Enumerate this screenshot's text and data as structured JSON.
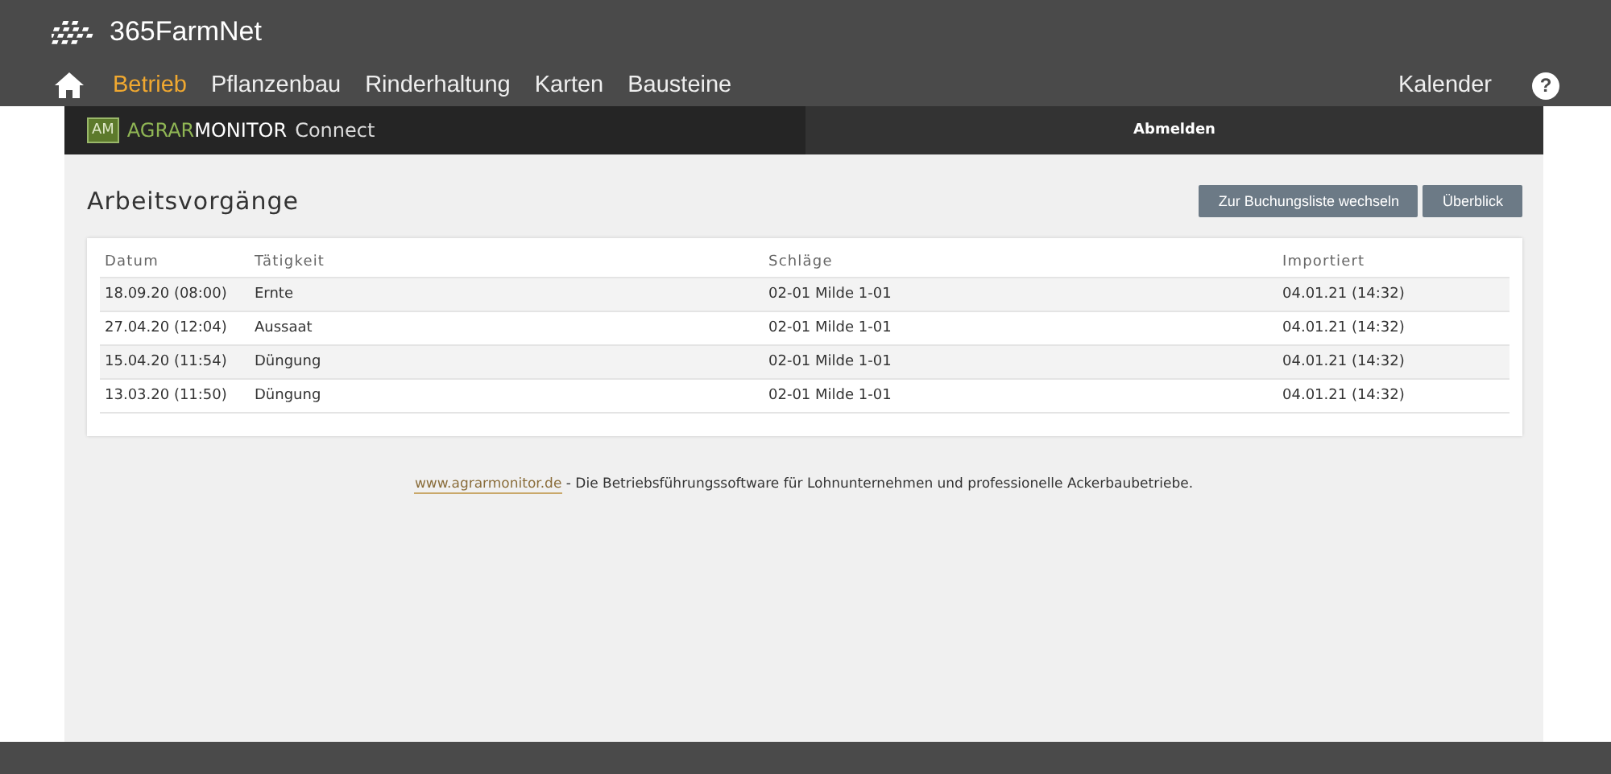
{
  "header": {
    "logo_text": "365FarmNet",
    "nav": [
      {
        "label": "Betrieb",
        "selected": true
      },
      {
        "label": "Pflanzenbau",
        "selected": false
      },
      {
        "label": "Rinderhaltung",
        "selected": false
      },
      {
        "label": "Karten",
        "selected": false
      },
      {
        "label": "Bausteine",
        "selected": false
      }
    ],
    "calendar": "Kalender",
    "help": "?"
  },
  "app_bar": {
    "logo_mark": "AM",
    "brand_first": "AGRAR",
    "brand_second": "MONITOR",
    "brand_suffix": "Connect",
    "logout": "Abmelden"
  },
  "page": {
    "title": "Arbeitsvorgänge",
    "buttons": [
      "Zur Buchungsliste wechseln",
      "Überblick"
    ]
  },
  "table": {
    "columns": [
      "Datum",
      "Tätigkeit",
      "Schläge",
      "Importiert"
    ],
    "rows": [
      [
        "18.09.20 (08:00)",
        "Ernte",
        "02-01 Milde 1-01",
        "04.01.21 (14:32)"
      ],
      [
        "27.04.20 (12:04)",
        "Aussaat",
        "02-01 Milde 1-01",
        "04.01.21 (14:32)"
      ],
      [
        "15.04.20 (11:54)",
        "Düngung",
        "02-01 Milde 1-01",
        "04.01.21 (14:32)"
      ],
      [
        "13.03.20 (11:50)",
        "Düngung",
        "02-01 Milde 1-01",
        "04.01.21 (14:32)"
      ]
    ]
  },
  "footer_note": {
    "link": "www.agrarmonitor.de",
    "text": " - Die Betriebsführungssoftware für Lohnunternehmen und professionelle Ackerbaubetriebe."
  }
}
